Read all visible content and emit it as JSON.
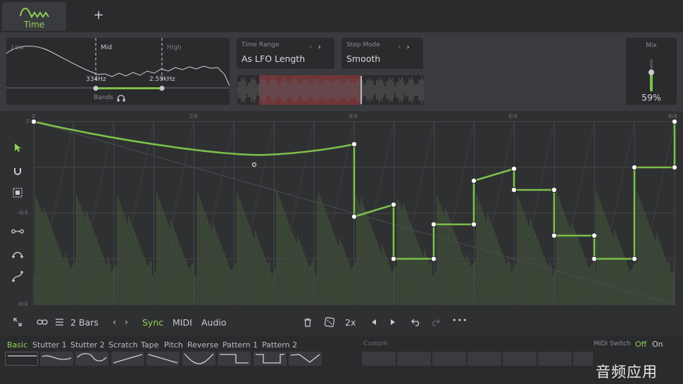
{
  "tabs": {
    "active_label": "Time",
    "add_label": "+"
  },
  "bands": {
    "low_label": "Low",
    "mid_label": "Mid",
    "high_label": "High",
    "low_freq": "334Hz",
    "high_freq": "2.59kHz",
    "title": "Bands"
  },
  "time_range": {
    "title": "Time Range",
    "value": "As LFO Length"
  },
  "step_mode": {
    "title": "Step Mode",
    "value": "Smooth"
  },
  "mix": {
    "title": "Mix",
    "value": "59%",
    "level": 0.59
  },
  "grid": {
    "top_labels": [
      "0",
      "2/4",
      "4/4",
      "6/4",
      "8/4"
    ],
    "left_labels": [
      "0",
      "-4/4",
      "-8/4"
    ]
  },
  "toolbar": {
    "length": "2 Bars",
    "sync": "Sync",
    "midi": "MIDI",
    "audio": "Audio",
    "rate": "2x",
    "more": "•••"
  },
  "presets": {
    "items": [
      "Basic",
      "Stutter 1",
      "Stutter 2",
      "Scratch",
      "Tape",
      "Pitch",
      "Reverse",
      "Pattern 1",
      "Pattern 2"
    ],
    "custom_title": "Custom",
    "midi_switch_title": "MIDI Switch",
    "midi_off": "Off",
    "midi_on": "On"
  },
  "watermark": "音频应用",
  "colors": {
    "accent": "#8fcf55",
    "curve": "#7cc04a"
  },
  "icons": [
    "time-logo-icon",
    "plus-icon",
    "headphones-icon",
    "arrow-pointer-icon",
    "magnet-icon",
    "select-box-icon",
    "node-link-icon",
    "curve-arc-icon",
    "curve-s-icon",
    "expand-icon",
    "link-icon",
    "list-icon",
    "trash-icon",
    "dice-icon",
    "play-left-icon",
    "play-right-icon",
    "undo-icon",
    "redo-icon"
  ]
}
